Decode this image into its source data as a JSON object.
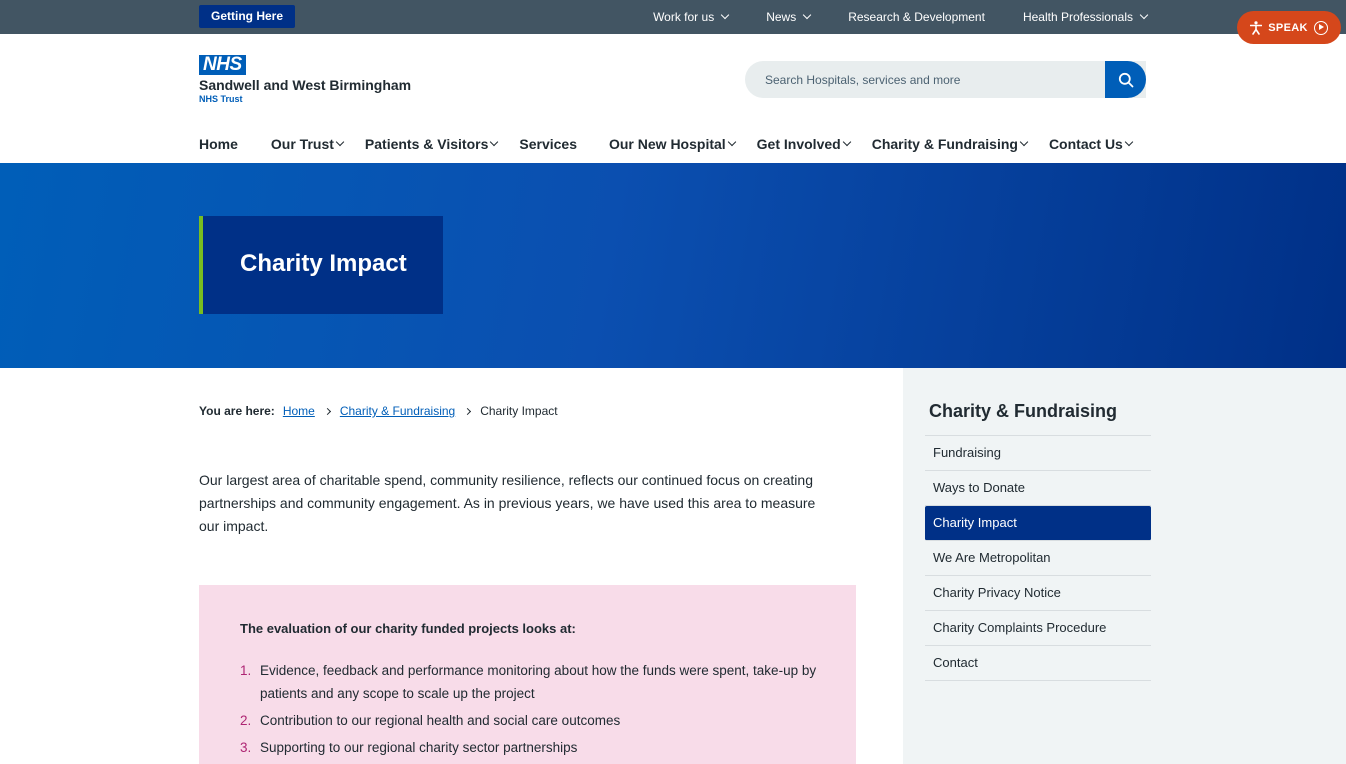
{
  "topbar": {
    "getting_here": "Getting Here",
    "links": [
      "Work for us",
      "News",
      "Research & Development",
      "Health Professionals"
    ],
    "speak": "SPEAK"
  },
  "header": {
    "nhs_logo": "NHS",
    "org_name": "Sandwell and West Birmingham",
    "org_sub": "NHS Trust",
    "search_placeholder": "Search Hospitals, services and more"
  },
  "nav": {
    "items": [
      "Home",
      "Our Trust",
      "Patients & Visitors",
      "Services",
      "Our New Hospital",
      "Get Involved",
      "Charity & Fundraising",
      "Contact Us"
    ]
  },
  "hero": {
    "title": "Charity Impact"
  },
  "breadcrumb": {
    "label": "You are here:",
    "links": [
      "Home",
      "Charity & Fundraising"
    ],
    "current": "Charity Impact"
  },
  "intro": "Our largest area of charitable spend, community resilience, reflects our continued focus on creating partnerships and community engagement. As in previous years, we have used this area to measure our impact.",
  "panel": {
    "heading": "The evaluation of our charity funded projects looks at:",
    "items": [
      {
        "num": "1.",
        "text": "Evidence, feedback and performance monitoring about how the funds were spent, take-up by patients and any scope to scale up the project"
      },
      {
        "num": "2.",
        "text": "Contribution to our regional health and social care outcomes"
      },
      {
        "num": "3.",
        "text": "Supporting to our regional charity sector partnerships"
      }
    ]
  },
  "sidebar": {
    "title": "Charity & Fundraising",
    "items": [
      "Fundraising",
      "Ways to Donate",
      "Charity Impact",
      "We Are Metropolitan",
      "Charity Privacy Notice",
      "Charity Complaints Procedure",
      "Contact"
    ]
  },
  "colors": {
    "nhs_blue": "#005eb8",
    "dark_blue": "#003087",
    "top_bar": "#425563",
    "speak_orange": "#d5471b",
    "accent_green": "#78be20",
    "panel_pink": "#f8dce9",
    "sidebar_grey": "#f0f4f5"
  }
}
